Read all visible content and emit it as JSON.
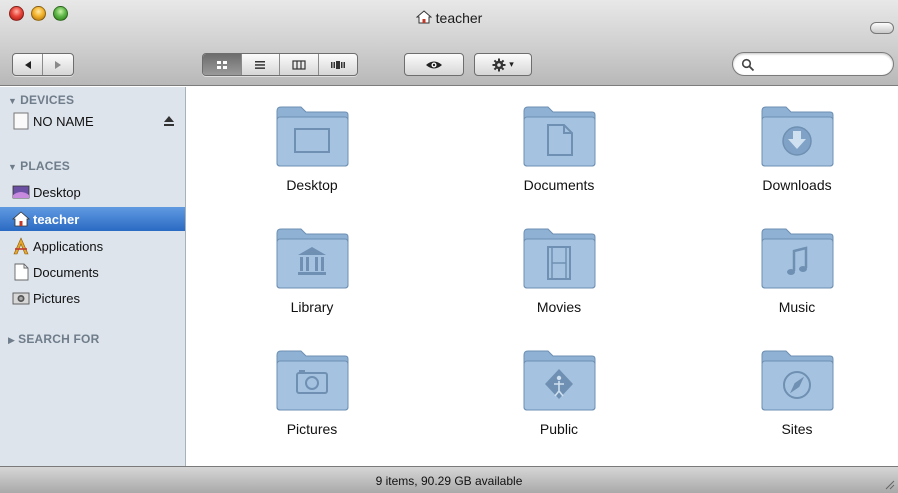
{
  "window": {
    "title": "teacher"
  },
  "toolbar": {
    "back_icon": "back-arrow-icon",
    "forward_icon": "forward-arrow-icon",
    "view_modes": [
      "icon-view",
      "list-view",
      "column-view",
      "coverflow-view"
    ],
    "active_view": "icon-view",
    "quicklook_icon": "eye-icon",
    "action_icon": "gear-icon",
    "search_placeholder": ""
  },
  "sidebar": {
    "devices_header": "DEVICES",
    "devices": [
      {
        "label": "NO NAME",
        "icon": "drive-icon"
      }
    ],
    "places_header": "PLACES",
    "places": [
      {
        "label": "Desktop",
        "icon": "desktop-icon"
      },
      {
        "label": "teacher",
        "icon": "home-icon",
        "selected": true
      },
      {
        "label": "Applications",
        "icon": "applications-icon"
      },
      {
        "label": "Documents",
        "icon": "documents-icon"
      },
      {
        "label": "Pictures",
        "icon": "pictures-icon"
      }
    ],
    "search_header": "SEARCH FOR"
  },
  "main": {
    "items": [
      {
        "label": "Desktop",
        "icon": "desktop-folder-icon"
      },
      {
        "label": "Documents",
        "icon": "documents-folder-icon"
      },
      {
        "label": "Downloads",
        "icon": "downloads-folder-icon"
      },
      {
        "label": "Library",
        "icon": "library-folder-icon"
      },
      {
        "label": "Movies",
        "icon": "movies-folder-icon"
      },
      {
        "label": "Music",
        "icon": "music-folder-icon"
      },
      {
        "label": "Pictures",
        "icon": "pictures-folder-icon"
      },
      {
        "label": "Public",
        "icon": "public-folder-icon"
      },
      {
        "label": "Sites",
        "icon": "sites-folder-icon"
      }
    ]
  },
  "status": {
    "text": "9 items, 90.29 GB available"
  },
  "colors": {
    "sidebar_bg": "#dde4ec",
    "selection": "#3c79cf",
    "folder": "#8fb1d3"
  }
}
